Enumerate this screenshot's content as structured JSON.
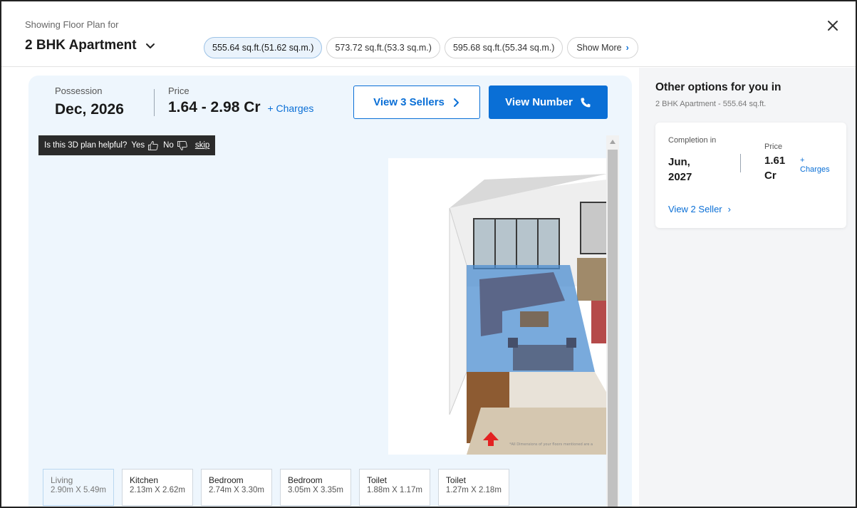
{
  "header": {
    "showing_label": "Showing Floor Plan for",
    "unit_title": "2 BHK Apartment",
    "size_tabs": [
      {
        "label": "555.64 sq.ft.(51.62 sq.m.)",
        "active": true
      },
      {
        "label": "573.72 sq.ft.(53.3 sq.m.)",
        "active": false
      },
      {
        "label": "595.68 sq.ft.(55.34 sq.m.)",
        "active": false
      }
    ],
    "show_more_label": "Show More",
    "show_more_chevron": "›",
    "close_icon": "close-icon"
  },
  "summary": {
    "possession_label": "Possession",
    "possession_value": "Dec, 2026",
    "price_label": "Price",
    "price_value": "1.64 - 2.98 Cr",
    "charges_label": "+ Charges",
    "view_sellers_label": "View 3 Sellers",
    "view_number_label": "View Number"
  },
  "feedback": {
    "question": "Is this 3D plan helpful?",
    "yes_label": "Yes",
    "no_label": "No",
    "skip_label": "skip"
  },
  "floor_plan": {
    "image": "3d-floor-plan-image",
    "disclaimer": "*All Dimensions of your floors mentioned are a"
  },
  "rooms": [
    {
      "name": "Living",
      "dim": "2.90m X 5.49m",
      "active": true
    },
    {
      "name": "Kitchen",
      "dim": "2.13m X 2.62m",
      "active": false
    },
    {
      "name": "Bedroom",
      "dim": "2.74m X 3.30m",
      "active": false
    },
    {
      "name": "Bedroom",
      "dim": "3.05m X 3.35m",
      "active": false
    },
    {
      "name": "Toilet",
      "dim": "1.88m X 1.17m",
      "active": false
    },
    {
      "name": "Toilet",
      "dim": "1.27m X 2.18m",
      "active": false
    }
  ],
  "right_panel": {
    "title": "Other options for you in",
    "subtitle": "2 BHK Apartment - 555.64 sq.ft.",
    "option": {
      "completion_label": "Completion in",
      "completion_value": "Jun, 2027",
      "price_label": "Price",
      "price_value": "1.61 Cr",
      "charges_label": "+ Charges",
      "link_label": "View 2 Seller",
      "link_chevron": "›"
    }
  },
  "colors": {
    "accent": "#0a6fd6",
    "main_bg": "#eef6fd",
    "panel_bg": "#f4f5f7",
    "feedback_bg": "#2b2b2b"
  }
}
